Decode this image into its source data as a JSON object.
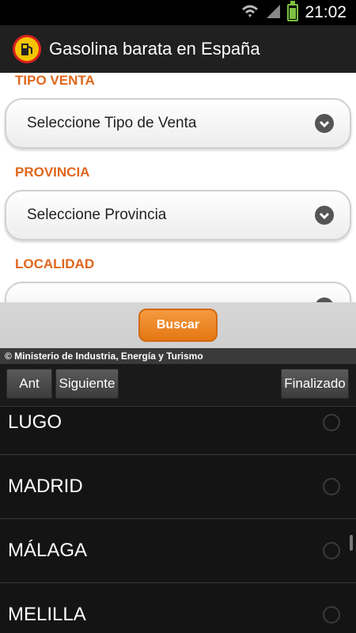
{
  "status_bar": {
    "time": "21:02"
  },
  "app": {
    "title": "Gasolina barata en España"
  },
  "form": {
    "tipo_venta_label": "TIPO VENTA",
    "tipo_venta_value": "Seleccione Tipo de Venta",
    "provincia_label": "PROVINCIA",
    "provincia_value": "Seleccione Provincia",
    "localidad_label": "LOCALIDAD"
  },
  "search_button": "Buscar",
  "credits": "© Ministerio de Industria, Energía y Turismo",
  "picker": {
    "prev_label": "Ant",
    "next_label": "Siguiente",
    "done_label": "Finalizado"
  },
  "list": {
    "items": [
      {
        "label": "LUGO"
      },
      {
        "label": "MADRID"
      },
      {
        "label": "MÁLAGA"
      },
      {
        "label": "MELILLA"
      }
    ]
  },
  "colors": {
    "accent": "#e0661c",
    "button": "#f0892a",
    "battery": "#7cc242"
  }
}
